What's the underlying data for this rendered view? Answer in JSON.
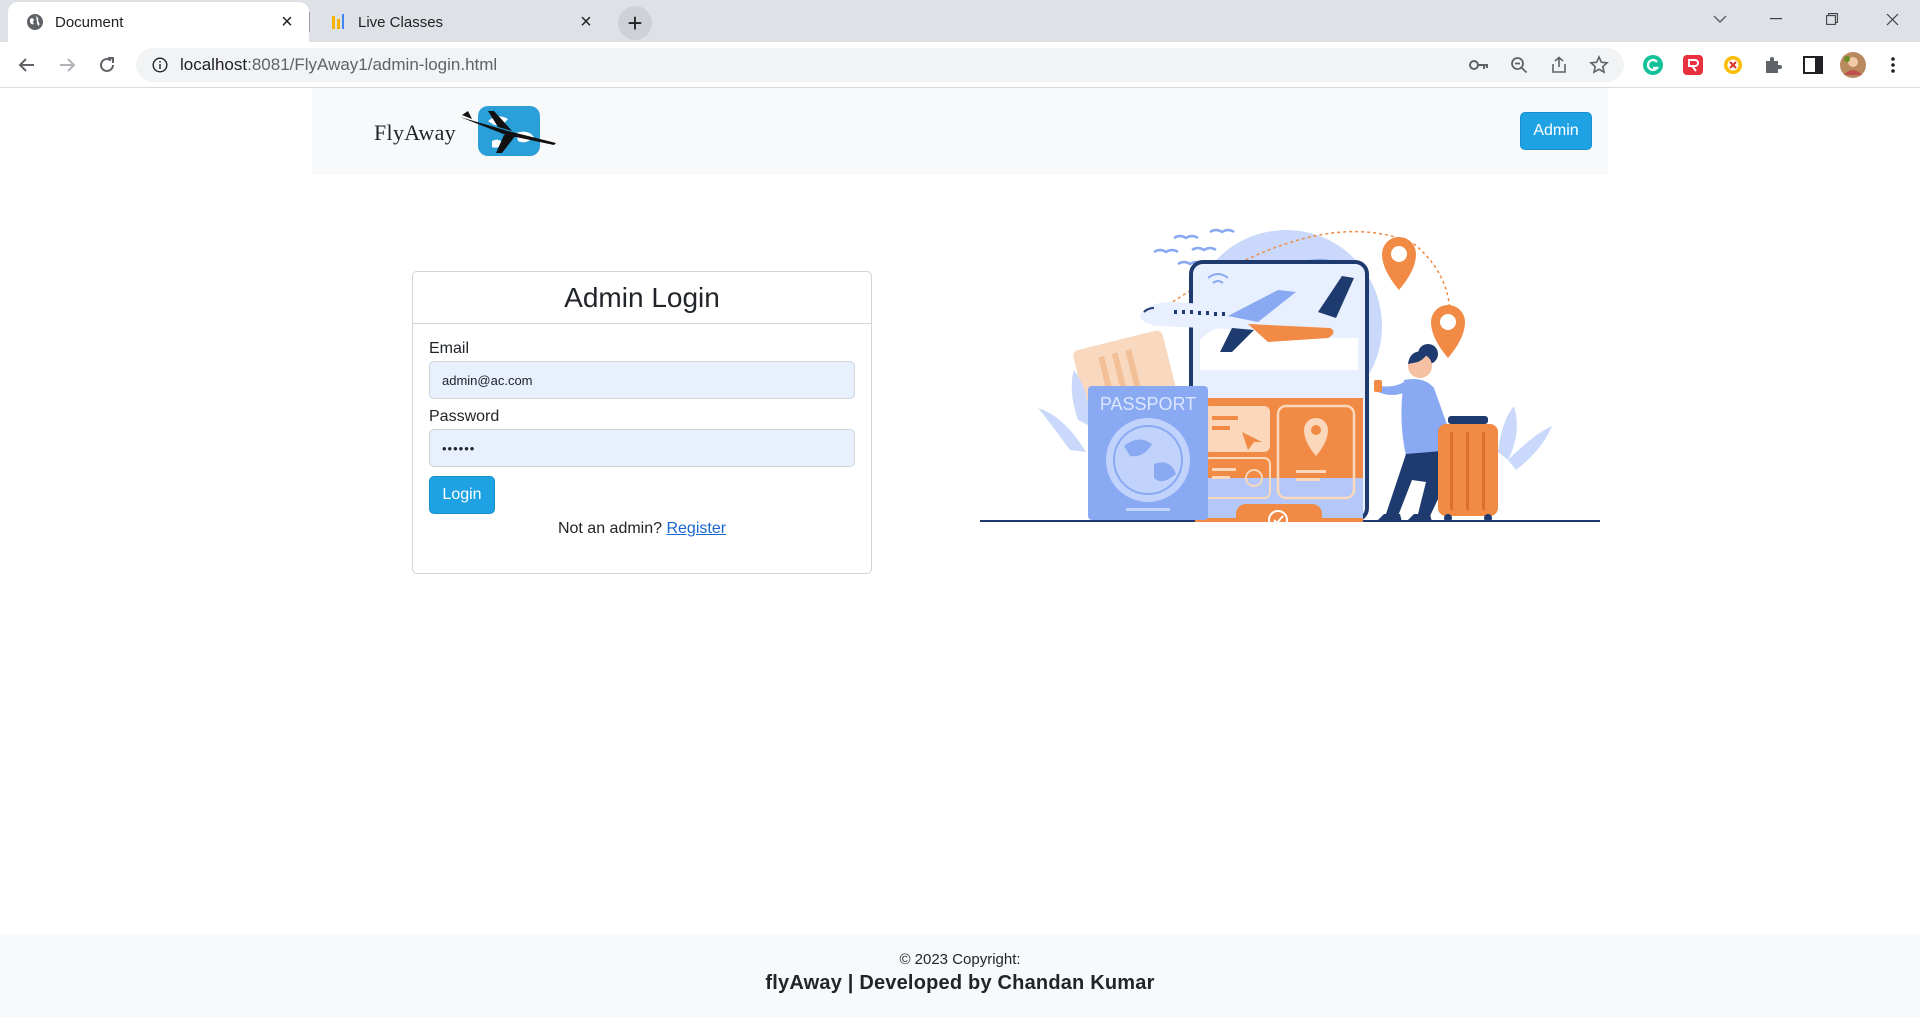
{
  "browser": {
    "tabs": [
      {
        "label": "Document",
        "active": true,
        "icon": "globe-icon"
      },
      {
        "label": "Live Classes",
        "active": false,
        "icon": "bar-chart-icon"
      }
    ],
    "address": {
      "host": "localhost",
      "path": ":8081/FlyAway1/admin-login.html"
    }
  },
  "navbar": {
    "brand": "FlyAway",
    "admin_label": "Admin"
  },
  "login": {
    "title": "Admin Login",
    "email_label": "Email",
    "email_value": "admin@ac.com",
    "password_label": "Password",
    "password_value": "••••••",
    "submit_label": "Login",
    "register_prompt": "Not an admin?",
    "register_link": "Register"
  },
  "illustration": {
    "passport_text": "PASSPORT"
  },
  "footer": {
    "copyright": "© 2023 Copyright:",
    "developer": "flyAway | Developed by Chandan Kumar"
  },
  "colors": {
    "primary": "#1fa2e4",
    "accent_orange": "#f08a44",
    "accent_blue": "#8aa9f3",
    "navy": "#1e3a6e"
  }
}
